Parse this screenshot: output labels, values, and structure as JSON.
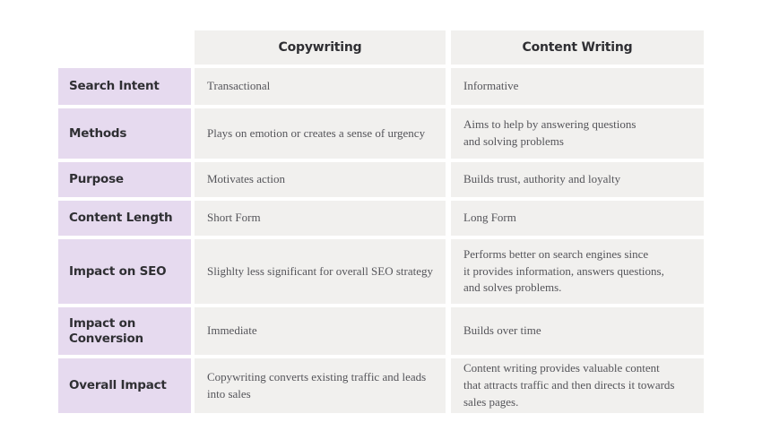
{
  "table": {
    "columns": [
      {
        "key": "attribute",
        "label": ""
      },
      {
        "key": "copywriting",
        "label": "Copywriting"
      },
      {
        "key": "content_writing",
        "label": "Content Writing"
      }
    ],
    "rows": [
      {
        "label": "Search Intent",
        "copywriting": "Transactional",
        "content_writing": "Informative"
      },
      {
        "label": "Methods",
        "copywriting": "Plays on emotion or creates a sense of urgency",
        "content_writing": "Aims to help by answering questions\nand solving problems"
      },
      {
        "label": "Purpose",
        "copywriting": "Motivates action",
        "content_writing": "Builds trust, authority and loyalty"
      },
      {
        "label": "Content Length",
        "copywriting": "Short Form",
        "content_writing": "Long Form"
      },
      {
        "label": "Impact on SEO",
        "copywriting": "Slighlty less significant for overall SEO strategy",
        "content_writing": "Performs better on search engines since\nit provides information, answers questions,\nand solves problems."
      },
      {
        "label": "Impact on Conversion",
        "copywriting": "Immediate",
        "content_writing": "Builds over time"
      },
      {
        "label": "Overall Impact",
        "copywriting": "Copywriting converts existing traffic and leads\ninto sales",
        "content_writing": "Content writing provides valuable content\nthat attracts traffic and then directs it towards\nsales pages."
      }
    ]
  },
  "colors": {
    "page_background": "#FFFFFF",
    "label_cell": "#E6DAEF",
    "value_cell": "#F1F0EE",
    "heading_text": "#2F2F33",
    "body_text": "#55555A"
  }
}
